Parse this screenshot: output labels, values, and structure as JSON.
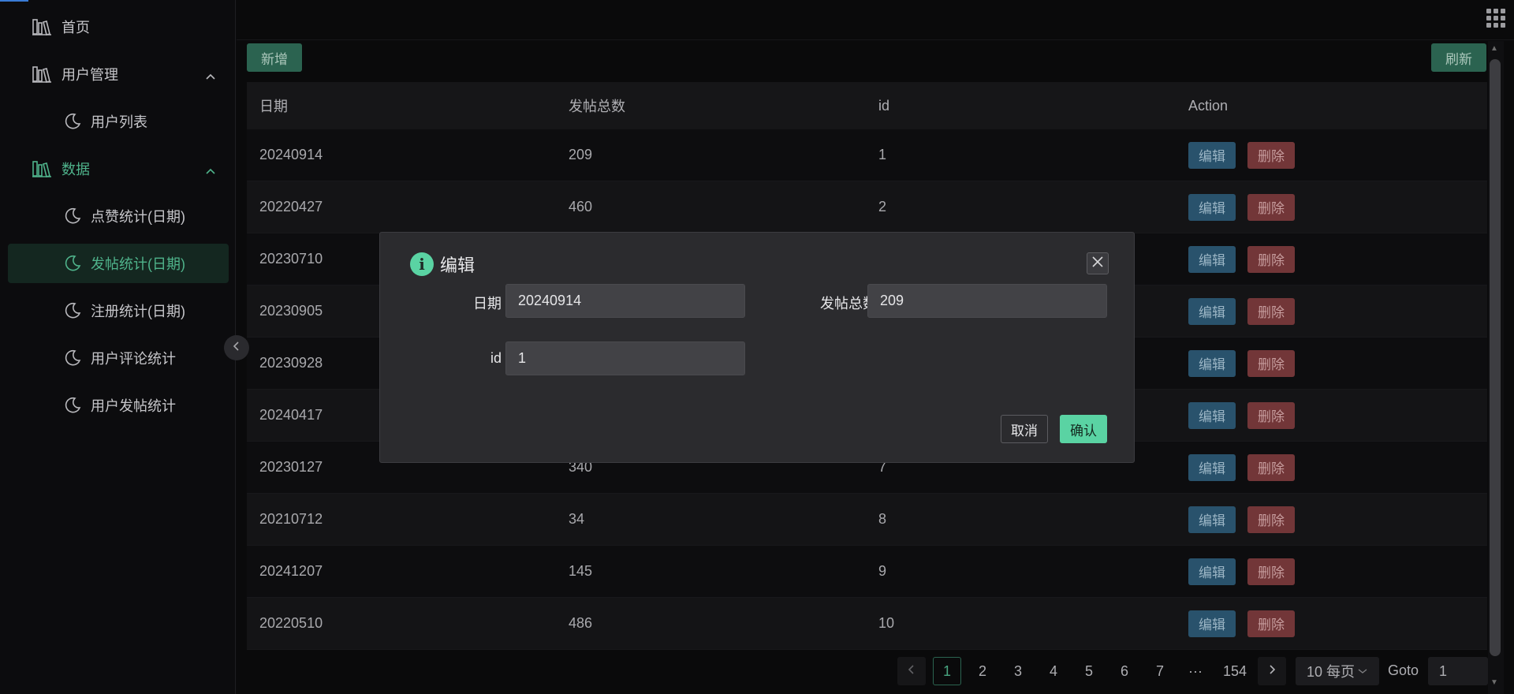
{
  "sidebar": {
    "items": [
      {
        "label": "首页",
        "icon": "library-icon"
      },
      {
        "label": "用户管理",
        "icon": "library-icon"
      },
      {
        "label": "用户列表",
        "icon": "moon-icon"
      },
      {
        "label": "数据",
        "icon": "library-icon"
      },
      {
        "label": "点赞统计(日期)",
        "icon": "moon-icon"
      },
      {
        "label": "发帖统计(日期)",
        "icon": "moon-icon"
      },
      {
        "label": "注册统计(日期)",
        "icon": "moon-icon"
      },
      {
        "label": "用户评论统计",
        "icon": "moon-icon"
      },
      {
        "label": "用户发帖统计",
        "icon": "moon-icon"
      }
    ]
  },
  "toolbar": {
    "add_label": "新增",
    "refresh_label": "刷新"
  },
  "table": {
    "headers": [
      "日期",
      "发帖总数",
      "id",
      "Action"
    ],
    "rows": [
      {
        "date": "20240914",
        "total": "209",
        "id": "1"
      },
      {
        "date": "20220427",
        "total": "460",
        "id": "2"
      },
      {
        "date": "20230710",
        "total": "",
        "id": ""
      },
      {
        "date": "20230905",
        "total": "",
        "id": ""
      },
      {
        "date": "20230928",
        "total": "",
        "id": ""
      },
      {
        "date": "20240417",
        "total": "",
        "id": ""
      },
      {
        "date": "20230127",
        "total": "340",
        "id": "7"
      },
      {
        "date": "20210712",
        "total": "34",
        "id": "8"
      },
      {
        "date": "20241207",
        "total": "145",
        "id": "9"
      },
      {
        "date": "20220510",
        "total": "486",
        "id": "10"
      }
    ],
    "edit_label": "编辑",
    "delete_label": "删除"
  },
  "modal": {
    "title": "编辑",
    "fields": {
      "date_label": "日期",
      "date_value": "20240914",
      "total_label": "发帖总数",
      "total_value": "209",
      "id_label": "id",
      "id_value": "1"
    },
    "cancel_label": "取消",
    "confirm_label": "确认"
  },
  "pagination": {
    "pages": [
      "1",
      "2",
      "3",
      "4",
      "5",
      "6",
      "7",
      "···",
      "154"
    ],
    "current": "1",
    "page_size": "10 每页",
    "goto_label": "Goto",
    "goto_value": "1"
  },
  "colors": {
    "accent": "#4fb38b",
    "edit": "#2d5a76",
    "delete": "#7c3b3d",
    "confirm": "#5ad3a3"
  }
}
